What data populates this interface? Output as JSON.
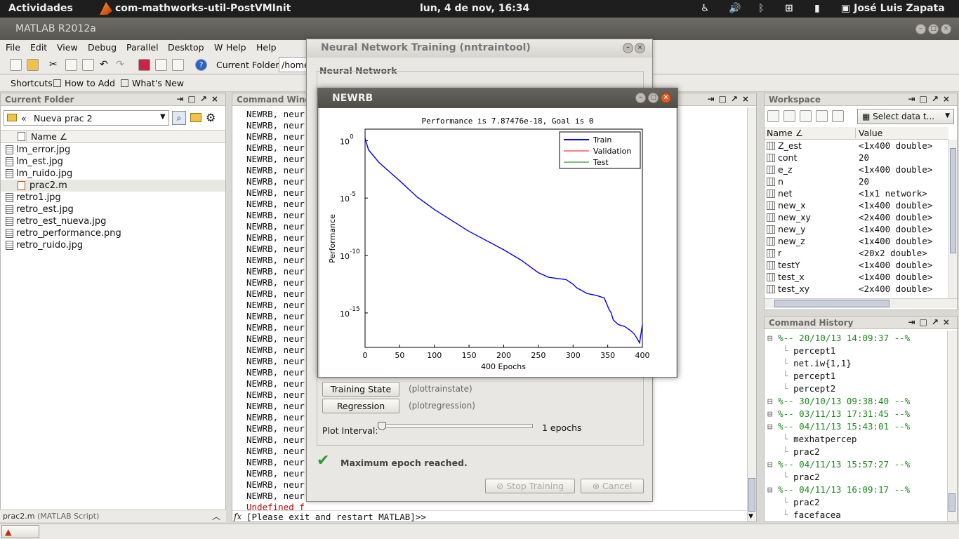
{
  "topbar": {
    "activities": "Actividades",
    "app_name": "com-mathworks-util-PostVMInit",
    "clock": "lun,  4 de nov, 16:34",
    "user": "José Luis Zapata"
  },
  "matlab": {
    "title": "MATLAB  R2012a",
    "menu": [
      "File",
      "Edit",
      "View",
      "Debug",
      "Parallel",
      "Desktop",
      "W",
      "Help",
      "Help"
    ],
    "current_folder_label": "Current Folder:",
    "current_folder_value": "/home",
    "shortcuts": [
      "Shortcuts",
      "How to Add",
      "What's New"
    ]
  },
  "current_folder": {
    "header": "Current Folder",
    "path": "Nueva prac 2",
    "col_name": "Name ∠",
    "files": [
      "lm_error.jpg",
      "lm_est.jpg",
      "lm_ruido.jpg",
      "prac2.m",
      "retro1.jpg",
      "retro_est.jpg",
      "retro_est_nueva.jpg",
      "retro_performance.png",
      "retro_ruido.jpg"
    ],
    "status_name": "prac2.m",
    "status_type": "(MATLAB Script)"
  },
  "command_window": {
    "header": "Command Windo",
    "repeated_line": "NEWRB, neur",
    "line_count": 35,
    "error_line": "Undefined f",
    "prompt_symbol": "fx",
    "prompt": "[Please exit and restart MATLAB]>>"
  },
  "workspace": {
    "header": "Workspace",
    "select_data": "Select data t...",
    "col_name": "Name ∠",
    "col_value": "Value",
    "vars": [
      {
        "name": "Z_est",
        "value": "<1x400 double>"
      },
      {
        "name": "cont",
        "value": "20"
      },
      {
        "name": "e_z",
        "value": "<1x400 double>"
      },
      {
        "name": "n",
        "value": "20"
      },
      {
        "name": "net",
        "value": "<1x1 network>"
      },
      {
        "name": "new_x",
        "value": "<1x400 double>"
      },
      {
        "name": "new_xy",
        "value": "<2x400 double>"
      },
      {
        "name": "new_y",
        "value": "<1x400 double>"
      },
      {
        "name": "new_z",
        "value": "<1x400 double>"
      },
      {
        "name": "r",
        "value": "<20x2 double>"
      },
      {
        "name": "testY",
        "value": "<1x400 double>"
      },
      {
        "name": "test_x",
        "value": "<1x400 double>"
      },
      {
        "name": "test_xy",
        "value": "<2x400 double>"
      }
    ]
  },
  "history": {
    "header": "Command History",
    "lines": [
      {
        "text": "%-- 20/10/13 14:09:37 --%",
        "session": true
      },
      {
        "text": "percept1",
        "session": false
      },
      {
        "text": "net.iw{1,1}",
        "session": false
      },
      {
        "text": "percept1",
        "session": false
      },
      {
        "text": "percept2",
        "session": false
      },
      {
        "text": "%-- 30/10/13 09:38:40 --%",
        "session": true
      },
      {
        "text": "%-- 03/11/13 17:31:45 --%",
        "session": true
      },
      {
        "text": "%-- 04/11/13 15:43:01 --%",
        "session": true
      },
      {
        "text": "mexhatpercep",
        "session": false
      },
      {
        "text": "prac2",
        "session": false
      },
      {
        "text": "%-- 04/11/13 15:57:27 --%",
        "session": true
      },
      {
        "text": "prac2",
        "session": false
      },
      {
        "text": "%-- 04/11/13 16:09:17 --%",
        "session": true
      },
      {
        "text": "prac2",
        "session": false
      },
      {
        "text": "facefacea",
        "session": false
      }
    ]
  },
  "nntraintool": {
    "title": "Neural Network Training (nntraintool)",
    "section": "Neural Network",
    "btn_training_state": "Training State",
    "fn_training_state": "(plottrainstate)",
    "btn_regression": "Regression",
    "fn_regression": "(plotregression)",
    "plot_interval_label": "Plot Interval:",
    "plot_interval_value": "1 epochs",
    "status": "Maximum epoch reached.",
    "btn_stop": "Stop Training",
    "btn_cancel": "Cancel"
  },
  "newrb": {
    "title": "NEWRB"
  },
  "chart_data": {
    "type": "line",
    "title": "Performance is 7.87476e-18, Goal is 0",
    "xlabel": "400 Epochs",
    "ylabel": "Performance",
    "xlim": [
      0,
      400
    ],
    "ylim_log10": [
      -18,
      1
    ],
    "y_scale": "log",
    "xticks": [
      "0",
      "50",
      "100",
      "150",
      "200",
      "250",
      "300",
      "350",
      "400"
    ],
    "yticks": [
      {
        "base": "10",
        "exp": "0",
        "value": 0
      },
      {
        "base": "10",
        "exp": "-5",
        "value": -5
      },
      {
        "base": "10",
        "exp": "-10",
        "value": -10
      },
      {
        "base": "10",
        "exp": "-15",
        "value": -15
      }
    ],
    "legend_position": "top-right",
    "series": [
      {
        "name": "Train",
        "color": "#0000ff",
        "x": [
          0,
          5,
          20,
          50,
          75,
          100,
          150,
          200,
          225,
          250,
          265,
          290,
          300,
          305,
          320,
          335,
          345,
          352,
          355,
          358,
          365,
          375,
          382,
          388,
          392,
          396,
          398,
          400
        ],
        "log10_y": [
          0.2,
          -0.8,
          -1.9,
          -3.5,
          -4.9,
          -6.0,
          -7.9,
          -9.5,
          -10.4,
          -11.5,
          -11.9,
          -12.1,
          -12.5,
          -12.8,
          -13.3,
          -13.5,
          -13.7,
          -14.7,
          -15.0,
          -15.6,
          -16.0,
          -16.2,
          -16.5,
          -16.8,
          -17.2,
          -17.6,
          -16.8,
          -16.0
        ]
      },
      {
        "name": "Validation",
        "color": "#ff0000",
        "x": [],
        "log10_y": []
      },
      {
        "name": "Test",
        "color": "#008000",
        "x": [],
        "log10_y": []
      }
    ]
  }
}
